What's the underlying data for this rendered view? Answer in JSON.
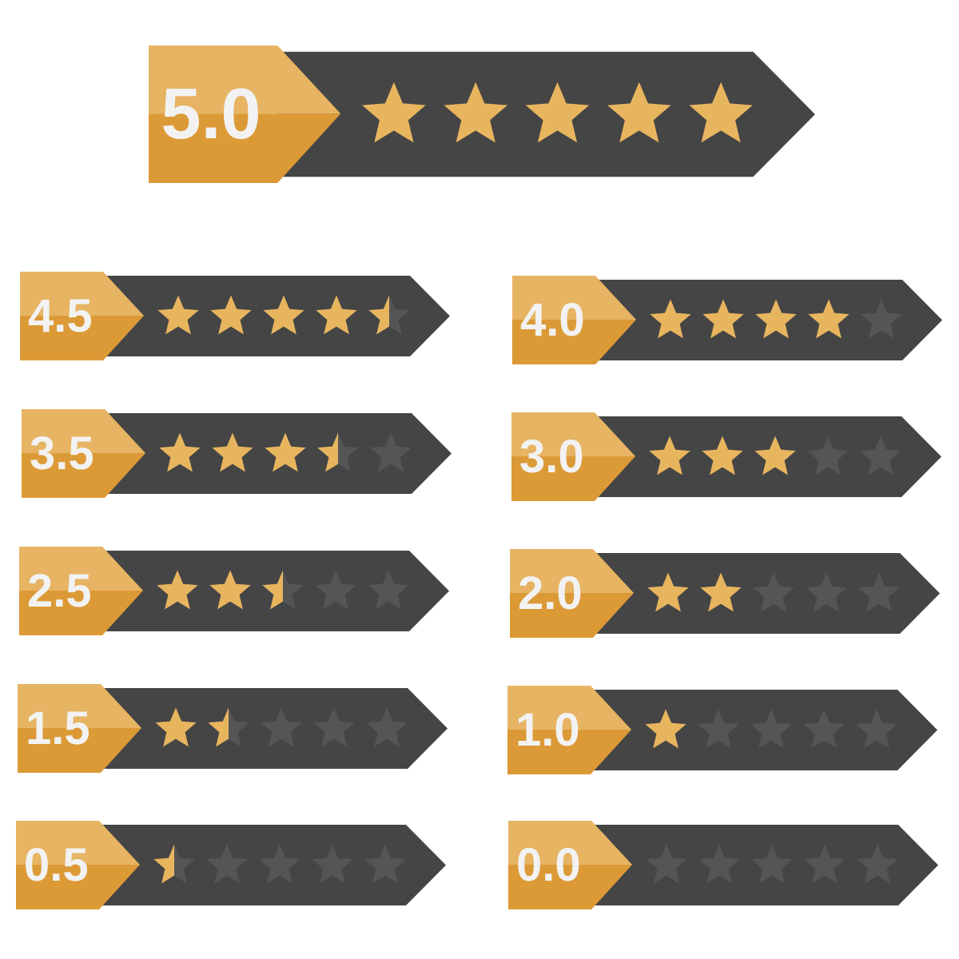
{
  "colors": {
    "bar": "#454545",
    "tag_top": "#e6b462",
    "tag_bottom": "#dc9a37",
    "star_on": "#e8b55f",
    "star_off": "#555555",
    "text": "#f2f2f2"
  },
  "ratings": [
    {
      "id": "r50",
      "label": "5.0",
      "value": 5.0,
      "max": 5
    },
    {
      "id": "r45",
      "label": "4.5",
      "value": 4.5,
      "max": 5
    },
    {
      "id": "r40",
      "label": "4.0",
      "value": 4.0,
      "max": 5
    },
    {
      "id": "r35",
      "label": "3.5",
      "value": 3.5,
      "max": 5
    },
    {
      "id": "r30",
      "label": "3.0",
      "value": 3.0,
      "max": 5
    },
    {
      "id": "r25",
      "label": "2.5",
      "value": 2.5,
      "max": 5
    },
    {
      "id": "r20",
      "label": "2.0",
      "value": 2.0,
      "max": 5
    },
    {
      "id": "r15",
      "label": "1.5",
      "value": 1.5,
      "max": 5
    },
    {
      "id": "r10",
      "label": "1.0",
      "value": 1.0,
      "max": 5
    },
    {
      "id": "r05",
      "label": "0.5",
      "value": 0.5,
      "max": 5
    },
    {
      "id": "r00",
      "label": "0.0",
      "value": 0.0,
      "max": 5
    }
  ]
}
